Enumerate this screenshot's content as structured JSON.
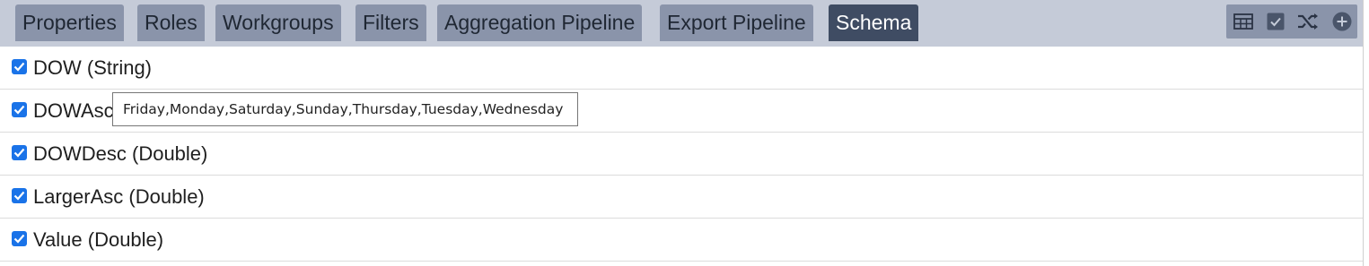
{
  "tabs": [
    {
      "label": "Properties",
      "active": false
    },
    {
      "label": "Roles",
      "active": false
    },
    {
      "label": "Workgroups",
      "active": false
    },
    {
      "label": "Filters",
      "active": false
    },
    {
      "label": "Aggregation Pipeline",
      "active": false
    },
    {
      "label": "Export Pipeline",
      "active": false
    },
    {
      "label": "Schema",
      "active": true
    }
  ],
  "toolbar": {
    "icons": [
      "table-icon",
      "check-box-icon",
      "shuffle-icon",
      "add-circle-icon"
    ]
  },
  "schema_fields": [
    {
      "label": "DOW (String)",
      "checked": true
    },
    {
      "label": "DOWAsc (Double)",
      "checked": true
    },
    {
      "label": "DOWDesc (Double)",
      "checked": true
    },
    {
      "label": "LargerAsc (Double)",
      "checked": true
    },
    {
      "label": "Value (Double)",
      "checked": true
    }
  ],
  "tooltip": {
    "text": "Friday,Monday,Saturday,Sunday,Thursday,Tuesday,Wednesday"
  },
  "colors": {
    "tabbar_bg": "#c5cbd8",
    "tab_bg": "#8a94aa",
    "tab_active_bg": "#3f4c63",
    "checkbox": "#1a73e8"
  }
}
